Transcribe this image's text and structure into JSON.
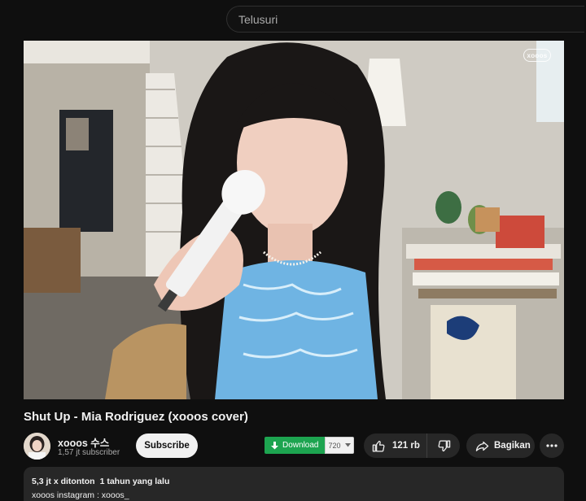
{
  "search": {
    "placeholder": "Telusuri"
  },
  "player": {
    "watermark": "xooos"
  },
  "video": {
    "title": "Shut Up - Mia Rodriguez (xooos cover)"
  },
  "channel": {
    "name": "xooos 수스",
    "subscribers": "1,57 jt subscriber",
    "subscribe_label": "Subscribe"
  },
  "download": {
    "label": "Download",
    "quality": "720"
  },
  "actions": {
    "likes": "121 rb",
    "share_label": "Bagikan"
  },
  "description": {
    "views": "5,3 jt x ditonton",
    "date": "1 tahun yang lalu",
    "text": "xooos instagram : xooos_"
  },
  "colors": {
    "background": "#0f0f0f",
    "pill": "#272727",
    "download_green": "#1da450"
  }
}
